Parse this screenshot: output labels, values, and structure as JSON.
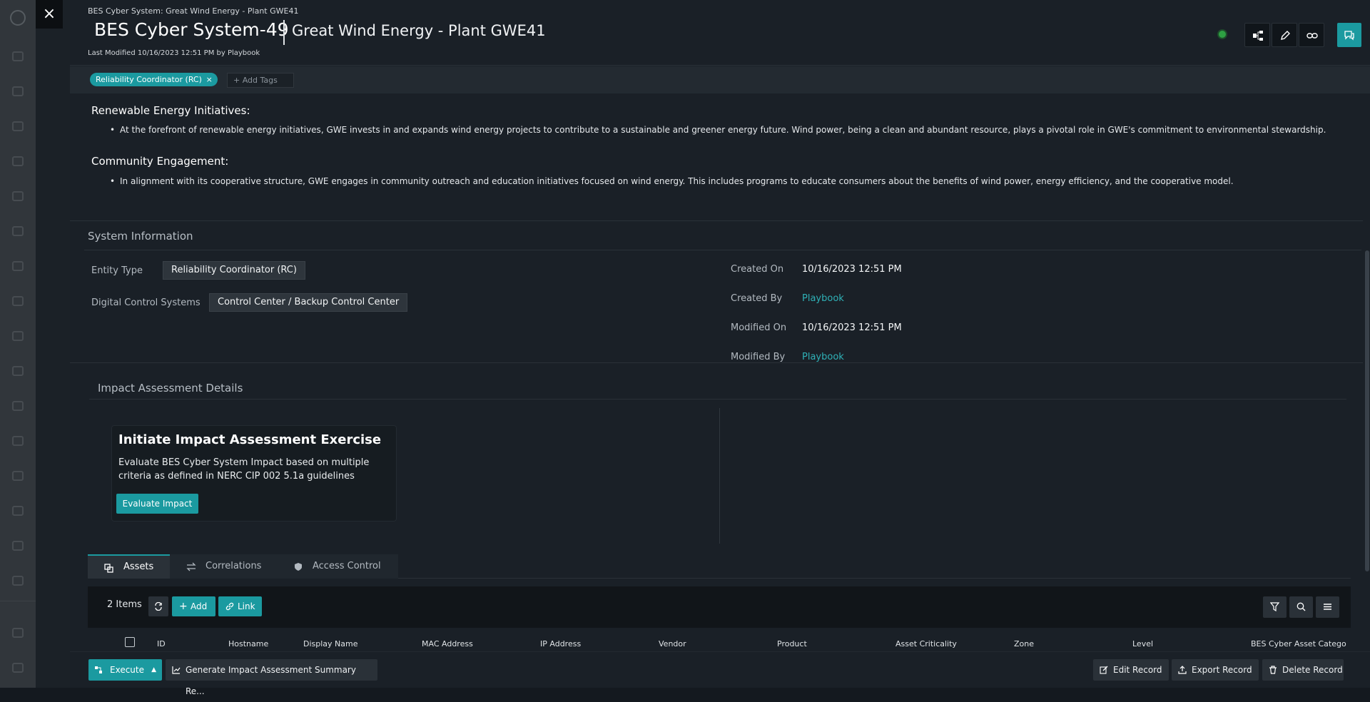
{
  "window": {
    "breadcrumb": "BES Cyber System: Great Wind Energy - Plant GWE41",
    "title": "BES Cyber System-49",
    "subtitle": "Great Wind Energy - Plant GWE41",
    "last_modified": "Last Modified 10/16/2023 12:51 PM by Playbook",
    "close_icon": "×",
    "status_color": "#2ea043",
    "accent_color": "#1b9aa0"
  },
  "tags": {
    "items": [
      {
        "label": "Reliability Coordinator (RC)",
        "remove": "×"
      }
    ],
    "add_placeholder": "+ Add Tags"
  },
  "description": {
    "sections": [
      {
        "heading": "Renewable Energy Initiatives:",
        "bullet": "At the forefront of renewable energy initiatives, GWE invests in and expands wind energy projects to contribute to a sustainable and greener energy future. Wind power, being a clean and abundant resource, plays a pivotal role in GWE's commitment to environmental stewardship."
      },
      {
        "heading": "Community Engagement:",
        "bullet": "In alignment with its cooperative structure, GWE engages in community outreach and education initiatives focused on wind energy. This includes programs to educate consumers about the benefits of wind power, energy efficiency, and the cooperative model."
      }
    ]
  },
  "system_info": {
    "title": "System Information",
    "entity_type_label": "Entity Type",
    "entity_type_value": "Reliability Coordinator (RC)",
    "dcs_label": "Digital Control Systems",
    "dcs_value": "Control Center / Backup Control Center",
    "created_on_label": "Created On",
    "created_on_value": "10/16/2023 12:51 PM",
    "created_by_label": "Created By",
    "created_by_value": "Playbook",
    "modified_on_label": "Modified On",
    "modified_on_value": "10/16/2023 12:51 PM",
    "modified_by_label": "Modified By",
    "modified_by_value": "Playbook"
  },
  "impact": {
    "title": "Impact Assessment Details",
    "card_title": "Initiate Impact Assessment Exercise",
    "card_desc": "Evaluate BES Cyber System Impact based on multiple criteria as defined in NERC CIP 002 5.1a guidelines",
    "button": "Evaluate Impact"
  },
  "tabs": [
    {
      "label": "Assets",
      "icon": "assets-icon",
      "active": true
    },
    {
      "label": "Correlations",
      "icon": "correlations-icon",
      "active": false
    },
    {
      "label": "Access Control",
      "icon": "shield-icon",
      "active": false
    }
  ],
  "grid": {
    "count": "2 Items",
    "add": "Add",
    "link": "Link",
    "columns": [
      "ID",
      "Hostname",
      "Display Name",
      "MAC Address",
      "IP Address",
      "Vendor",
      "Product",
      "Asset Criticality",
      "Zone",
      "Level",
      "BES Cyber Asset Catego"
    ]
  },
  "footer": {
    "execute": "Execute",
    "report": "Generate Impact Assessment Summary Re...",
    "edit": "Edit Record",
    "export": "Export Record",
    "delete": "Delete Record"
  }
}
